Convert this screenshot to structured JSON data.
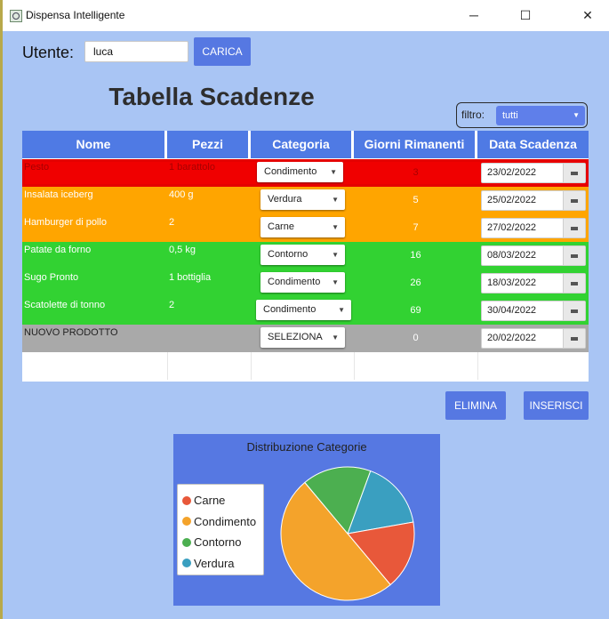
{
  "window": {
    "title": "Dispensa Intelligente",
    "controls": [
      "─",
      "☐",
      "✕"
    ]
  },
  "user": {
    "label": "Utente:",
    "value": "luca",
    "load_button": "CARICA"
  },
  "page_title": "Tabella Scadenze",
  "filter": {
    "label": "filtro:",
    "value": "tutti"
  },
  "table": {
    "headers": [
      "Nome",
      "Pezzi",
      "Categoria",
      "Giorni Rimanenti",
      "Data Scadenza"
    ],
    "rows": [
      {
        "nome": "Pesto",
        "pezzi": "1 barattolo",
        "categoria": "Condimento",
        "giorni": "3",
        "data": "23/02/2022",
        "color": "#f00000",
        "text_color": "#a80000",
        "selected": true
      },
      {
        "nome": "Insalata iceberg",
        "pezzi": "400 g",
        "categoria": "Verdura",
        "giorni": "5",
        "data": "25/02/2022",
        "color": "#ffa500",
        "text_color": "#ffffff",
        "selected": false
      },
      {
        "nome": "Hamburger di pollo",
        "pezzi": "2",
        "categoria": "Carne",
        "giorni": "7",
        "data": "27/02/2022",
        "color": "#ffa500",
        "text_color": "#ffffff",
        "selected": false
      },
      {
        "nome": "Patate da forno",
        "pezzi": "0,5 kg",
        "categoria": "Contorno",
        "giorni": "16",
        "data": "08/03/2022",
        "color": "#32d232",
        "text_color": "#ffffff",
        "selected": false
      },
      {
        "nome": "Sugo Pronto",
        "pezzi": "1 bottiglia",
        "categoria": "Condimento",
        "giorni": "26",
        "data": "18/03/2022",
        "color": "#32d232",
        "text_color": "#ffffff",
        "selected": false
      },
      {
        "nome": "Scatolette di tonno",
        "pezzi": "2",
        "categoria": "Condimento",
        "giorni": "69",
        "data": "30/04/2022",
        "color": "#32d232",
        "text_color": "#ffffff",
        "selected": false
      },
      {
        "nome": "NUOVO PRODOTTO",
        "pezzi": "",
        "categoria": "SELEZIONA",
        "giorni": "0",
        "data": "20/02/2022",
        "color": "#a9a9a9",
        "text_color": "#ffffff",
        "selected": false
      }
    ]
  },
  "actions": {
    "delete": "ELIMINA",
    "insert": "INSERISCI"
  },
  "chart_data": {
    "type": "pie",
    "title": "Distribuzione Categorie",
    "legend_position": "left",
    "categories": [
      "Carne",
      "Condimento",
      "Contorno",
      "Verdura"
    ],
    "values": [
      1,
      3,
      1,
      1
    ],
    "colors": [
      "#e8583a",
      "#f4a32b",
      "#4caf50",
      "#3a9fc0"
    ]
  }
}
